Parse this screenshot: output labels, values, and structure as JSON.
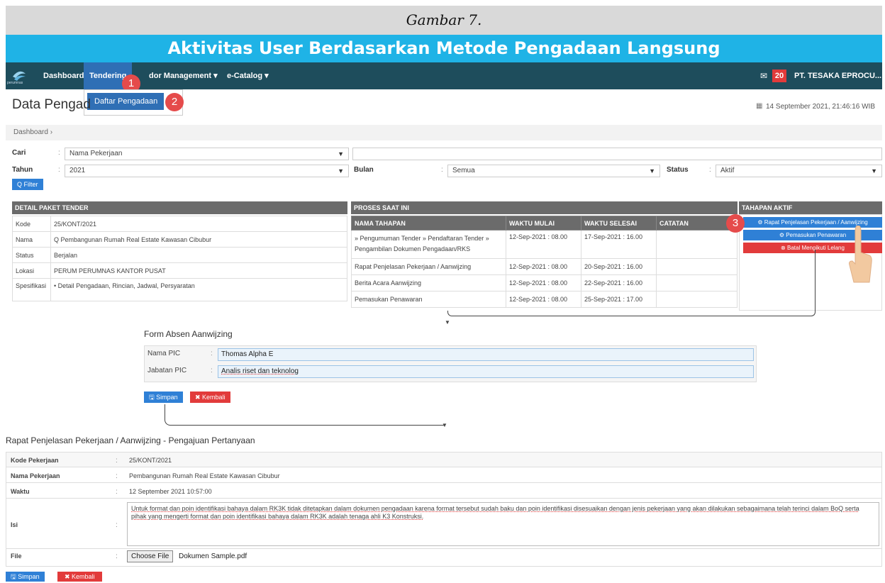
{
  "caption": "Gambar 7.",
  "page_heading": "Aktivitas User Berdasarkan Metode Pengadaan Langsung",
  "navbar": {
    "logo_text": "perumnas",
    "items": [
      "Dashboard",
      "Tendering",
      "dor Management ▾",
      "e-Catalog ▾"
    ],
    "mail_count": "20",
    "user": "PT. TESAKA EPROCU..."
  },
  "dropdown": {
    "item": "Daftar Pengadaan"
  },
  "steps": [
    "1",
    "2",
    "3"
  ],
  "page_title": "Data Pengad",
  "datetime": "14 September 2021, 21:46:16 WIB",
  "breadcrumb": "Dashboard ›",
  "filters": {
    "cari_label": "Cari",
    "cari_value": "Nama Pekerjaan",
    "tahun_label": "Tahun",
    "tahun_value": "2021",
    "bulan_label": "Bulan",
    "bulan_value": "Semua",
    "status_label": "Status",
    "status_value": "Aktif",
    "filter_button": "Q Filter"
  },
  "detail": {
    "heading": "DETAIL PAKET TENDER",
    "rows": [
      {
        "label": "Kode",
        "value": "25/KONT/2021"
      },
      {
        "label": "Nama",
        "value": "Q Pembangunan Rumah Real Estate Kawasan Cibubur"
      },
      {
        "label": "Status",
        "value": "Berjalan"
      },
      {
        "label": "Lokasi",
        "value": "PERUM PERUMNAS KANTOR PUSAT"
      },
      {
        "label": "Spesifikasi",
        "value": "•  Detail Pengadaan, Rincian, Jadwal, Persyaratan"
      }
    ]
  },
  "proses": {
    "heading": "PROSES SAAT INI",
    "columns": [
      "NAMA TAHAPAN",
      "WAKTU MULAI",
      "WAKTU SELESAI",
      "CATATAN"
    ],
    "rows": [
      {
        "nama": "» Pengumuman Tender » Pendaftaran Tender » Pengambilan Dokumen Pengadaan/RKS",
        "mulai": "12-Sep-2021 : 08.00",
        "selesai": "17-Sep-2021 : 16.00"
      },
      {
        "nama": "Rapat Penjelasan Pekerjaan / Aanwijzing",
        "mulai": "12-Sep-2021 : 08.00",
        "selesai": "20-Sep-2021 : 16.00"
      },
      {
        "nama": "Berita Acara Aanwijzing",
        "mulai": "12-Sep-2021 : 08.00",
        "selesai": "22-Sep-2021 : 16.00"
      },
      {
        "nama": "Pemasukan Penawaran",
        "mulai": "12-Sep-2021 : 08.00",
        "selesai": "25-Sep-2021 : 17.00"
      }
    ]
  },
  "tahapan": {
    "heading": "TAHAPAN AKTIF",
    "buttons": [
      "Rapat Penjelasan Pekerjaan / Aanwijzing",
      "Pemasukan Penawaran",
      "Batal Mengikuti Lelang"
    ]
  },
  "absen": {
    "title": "Form Absen Aanwijzing",
    "nama_label": "Nama PIC",
    "nama_value": "Thomas Alpha E",
    "jabatan_label": "Jabatan PIC",
    "jabatan_value": "Analis riset dan teknolog",
    "simpan": "Simpan",
    "kembali": "Kembali"
  },
  "rapat": {
    "title": "Rapat Penjelasan Pekerjaan / Aanwijzing - Pengajuan Pertanyaan",
    "rows": [
      {
        "label": "Kode Pekerjaan",
        "value": "25/KONT/2021"
      },
      {
        "label": "Nama Pekerjaan",
        "value": "Pembangunan Rumah Real Estate Kawasan Cibubur"
      },
      {
        "label": "Waktu",
        "value": "12 September 2021 10:57:00"
      }
    ],
    "isi_label": "Isi",
    "isi_value": "Untuk format dan poin identifikasi bahaya dalam RK3K tidak ditetapkan dalam dokumen pengadaan karena format tersebut sudah baku dan poin identifikasi disesuaikan dengan jenis pekerjaan yang akan dilakukan sebagaimana telah terinci dalam BoQ serta pihak yang mengerti format dan poin identifikasi bahaya dalam RK3K adalah tenaga ahli K3 Konstruksi.",
    "file_label": "File",
    "file_button": "Choose File",
    "file_name": "Dokumen Sample.pdf",
    "simpan": "Simpan",
    "kembali": "Kembali"
  },
  "separator": ":"
}
